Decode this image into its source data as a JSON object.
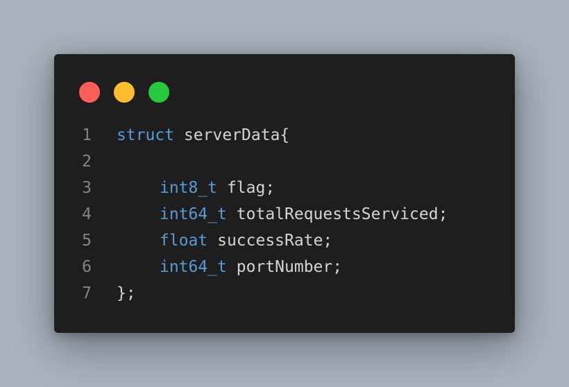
{
  "window": {
    "traffic_lights": [
      {
        "name": "close",
        "color": "#ff5f56"
      },
      {
        "name": "minimize",
        "color": "#ffbd2e"
      },
      {
        "name": "maximize",
        "color": "#27c93f"
      }
    ]
  },
  "code": {
    "lines": [
      {
        "number": "1",
        "keyword": "struct",
        "text": " serverData{"
      },
      {
        "number": "2",
        "keyword": "",
        "text": ""
      },
      {
        "number": "3",
        "keyword": "int8_t",
        "text": " flag;"
      },
      {
        "number": "4",
        "keyword": "int64_t",
        "text": " totalRequestsServiced;"
      },
      {
        "number": "5",
        "keyword": "float",
        "text": " successRate;"
      },
      {
        "number": "6",
        "keyword": "int64_t",
        "text": " portNumber;"
      },
      {
        "number": "7",
        "keyword": "",
        "text": "};"
      }
    ]
  },
  "colors": {
    "keyword": "#569cd6",
    "text": "#d4d4d4",
    "line_number": "#858585",
    "editor_bg": "#1e1e1e",
    "page_bg": "#a9b3bd"
  }
}
